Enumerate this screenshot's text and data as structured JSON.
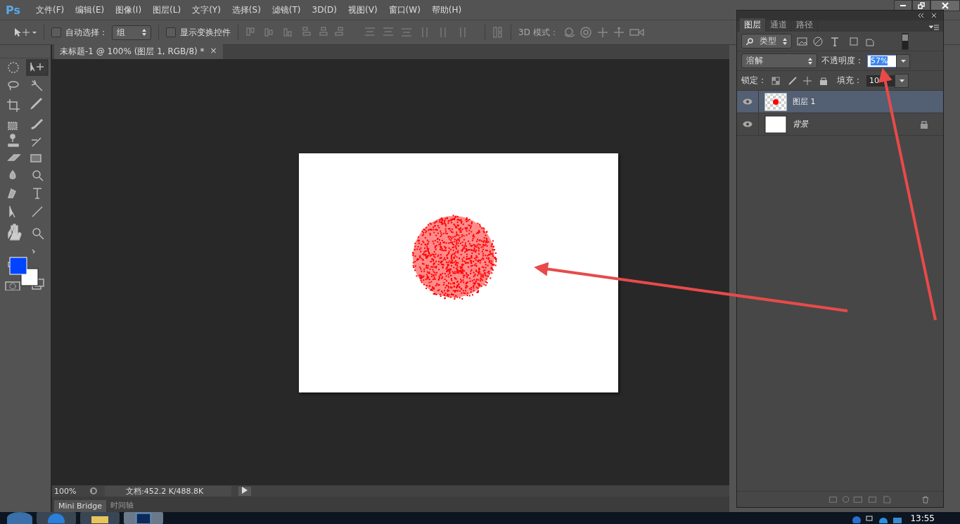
{
  "app": {
    "logo": "Ps"
  },
  "menu": [
    "文件(F)",
    "编辑(E)",
    "图像(I)",
    "图层(L)",
    "文字(Y)",
    "选择(S)",
    "滤镜(T)",
    "3D(D)",
    "视图(V)",
    "窗口(W)",
    "帮助(H)"
  ],
  "options_bar": {
    "auto_select": {
      "label": "自动选择：",
      "checked": false
    },
    "auto_select_target": "组",
    "show_transform": {
      "label": "显示变换控件",
      "checked": false
    },
    "mode_3d_label": "3D 模式："
  },
  "document_tab": {
    "title": "未标题-1 @ 100% (图层 1, RGB/8) *",
    "close": "×"
  },
  "swatches": {
    "foreground": {
      "color": "#0044ff"
    },
    "background": {
      "color": "#ffffff"
    }
  },
  "status_bar": {
    "zoom": "100%",
    "doc_info": "文档:452.2 K/488.8K"
  },
  "bottom_tabs": [
    {
      "label": "Mini Bridge",
      "selected": true
    },
    {
      "label": "时间轴",
      "selected": false
    }
  ],
  "layers_panel": {
    "tabs": [
      {
        "label": "图层",
        "selected": true
      },
      {
        "label": "通道",
        "selected": false
      },
      {
        "label": "路径",
        "selected": false
      }
    ],
    "filter_kind": "类型",
    "filter_on": true,
    "blend_mode": "溶解",
    "opacity_label": "不透明度：",
    "opacity": "57%",
    "lock_label": "锁定：",
    "fill_label": "填充：",
    "fill": "10",
    "layers": [
      {
        "name": "图层 1",
        "visible": true,
        "selected": true,
        "locked": false,
        "kind": "transparent"
      },
      {
        "name": "背景",
        "visible": true,
        "selected": false,
        "locked": true,
        "kind": "white"
      }
    ]
  },
  "taskbar": {
    "time": "13:55"
  }
}
